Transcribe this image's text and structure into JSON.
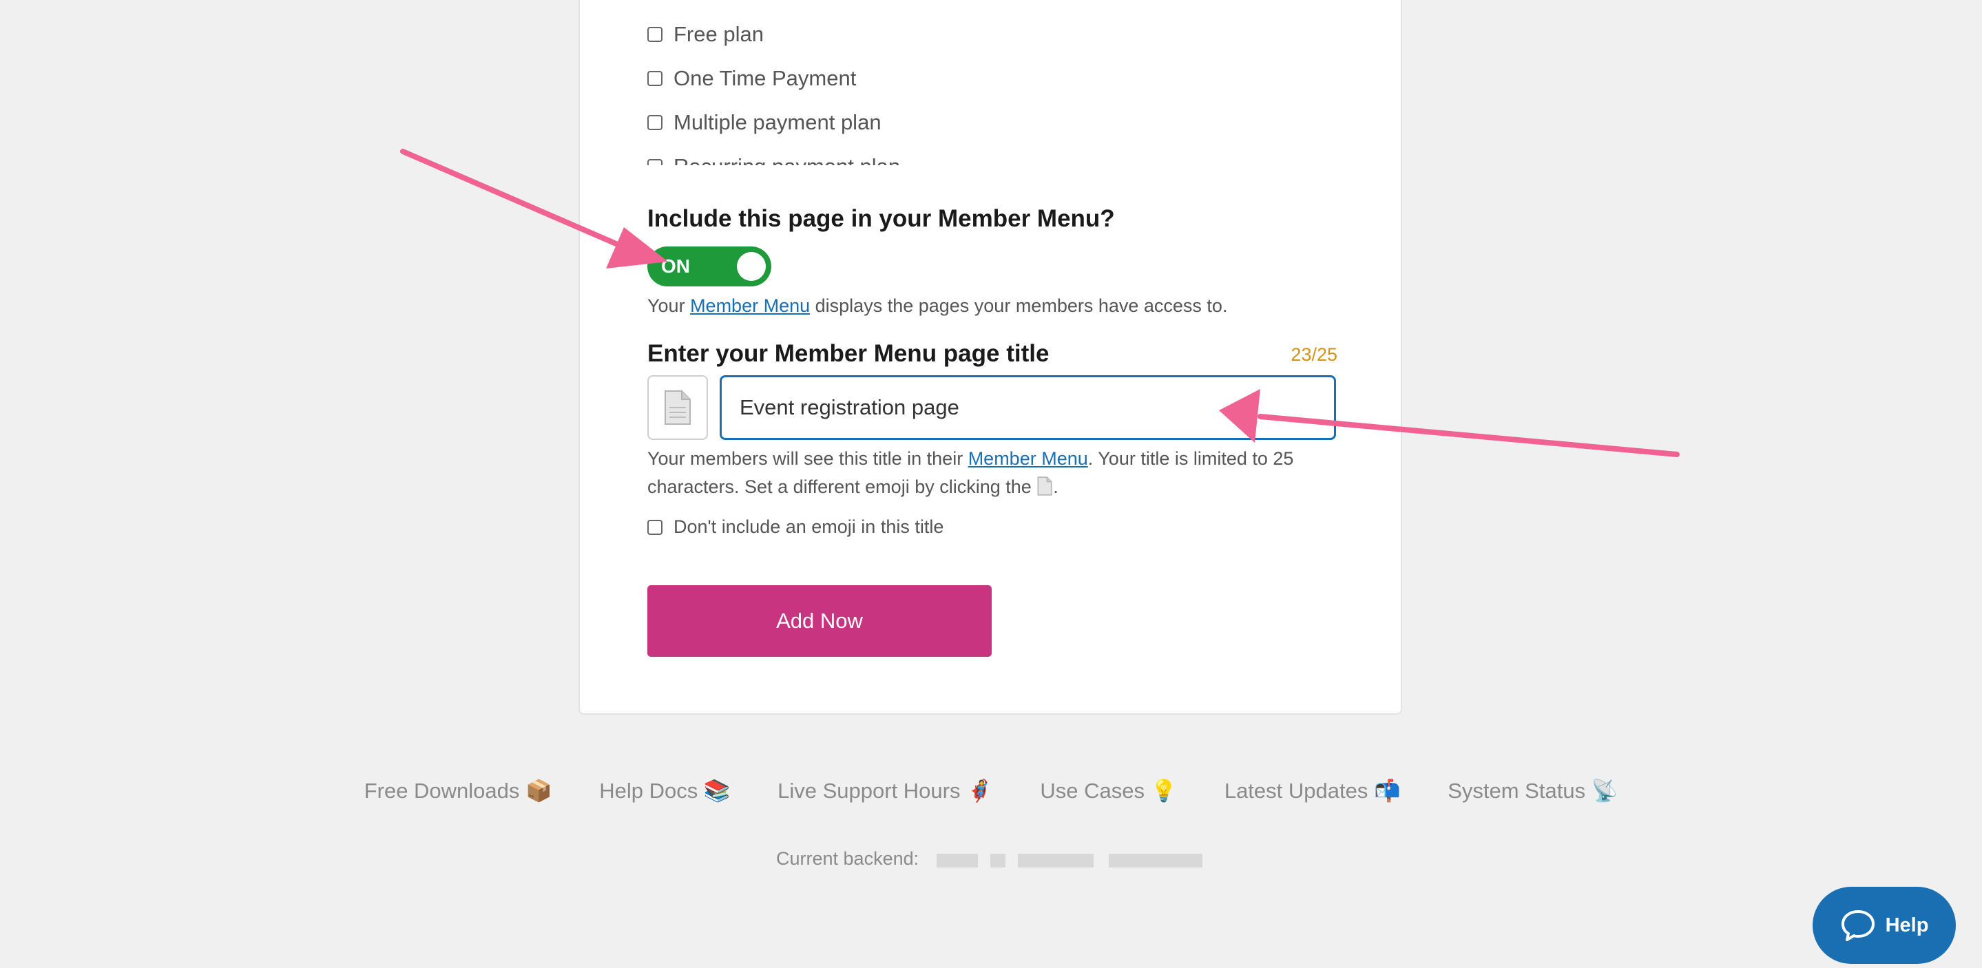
{
  "plans": [
    "Free plan",
    "One Time Payment",
    "Multiple payment plan",
    "Recurring payment plan"
  ],
  "member_menu": {
    "heading": "Include this page in your Member Menu?",
    "toggle_label": "ON",
    "desc_prefix": "Your ",
    "desc_link": "Member Menu",
    "desc_suffix": " displays the pages your members have access to."
  },
  "page_title": {
    "heading": "Enter your Member Menu page title",
    "counter": "23/25",
    "emoji_icon": "page-facing-up-icon",
    "value": "Event registration page",
    "help_prefix": "Your members will see this title in their ",
    "help_link": "Member Menu",
    "help_mid": ". Your title is limited to 25",
    "help_line2": "characters. Set a different emoji by clicking the ",
    "help_end": ".",
    "no_emoji_label": "Don't include an emoji in this title"
  },
  "add_button": "Add Now",
  "footer": {
    "links": [
      {
        "label": "Free Downloads",
        "emoji": "📦"
      },
      {
        "label": "Help Docs",
        "emoji": "📚"
      },
      {
        "label": "Live Support Hours",
        "emoji": "🦸"
      },
      {
        "label": "Use Cases",
        "emoji": "💡"
      },
      {
        "label": "Latest Updates",
        "emoji": "📬"
      },
      {
        "label": "System Status",
        "emoji": "📡"
      }
    ],
    "backend_label": "Current backend:"
  },
  "help_widget": "Help",
  "colors": {
    "toggle_on": "#1f9a3a",
    "accent": "#c8347f",
    "link": "#1a6fb3",
    "annotation_arrow": "#f06292"
  }
}
